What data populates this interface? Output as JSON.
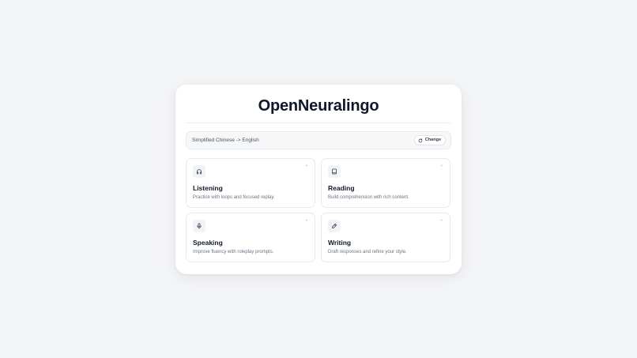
{
  "app": {
    "title": "OpenNeuralingo"
  },
  "language": {
    "pair": "Simplified Chinese -> English",
    "change_label": "Change"
  },
  "tiles": [
    {
      "title": "Listening",
      "description": "Practice with loops and focused replay.",
      "icon": "headphones-icon"
    },
    {
      "title": "Reading",
      "description": "Build comprehension with rich content.",
      "icon": "book-icon"
    },
    {
      "title": "Speaking",
      "description": "Improve fluency with roleplay prompts.",
      "icon": "microphone-icon"
    },
    {
      "title": "Writing",
      "description": "Draft responses and refine your style.",
      "icon": "pen-icon"
    }
  ],
  "colors": {
    "background": "#f4f5f7",
    "card": "#ffffff",
    "title": "#0f172a",
    "muted_text": "#6b7280"
  }
}
